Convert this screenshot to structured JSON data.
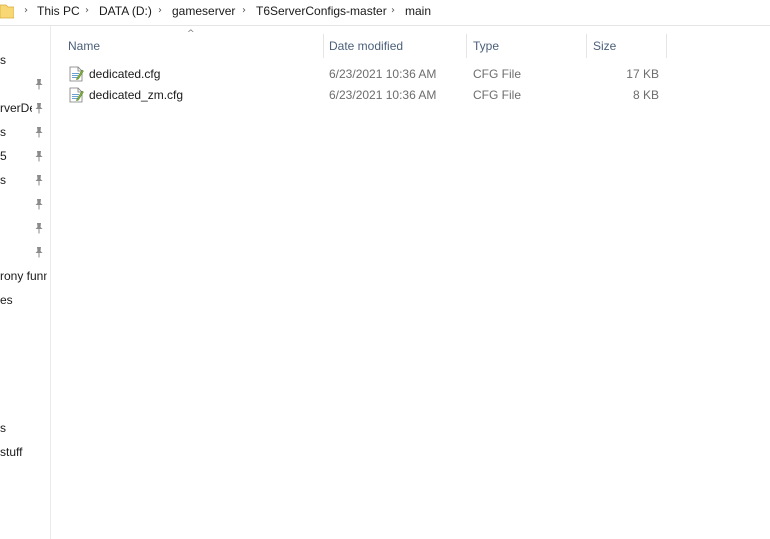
{
  "breadcrumb": {
    "separator": "›",
    "items": [
      "This PC",
      "DATA (D:)",
      "gameserver",
      "T6ServerConfigs-master",
      "main"
    ]
  },
  "nav_pane": {
    "items": [
      {
        "label": "s",
        "pinned": false
      },
      {
        "label": "",
        "pinned": true
      },
      {
        "label": "rverDefa",
        "pinned": true
      },
      {
        "label": "s",
        "pinned": true
      },
      {
        "label": "5",
        "pinned": true
      },
      {
        "label": "s",
        "pinned": true
      },
      {
        "label": "",
        "pinned": true
      },
      {
        "label": "",
        "pinned": true
      },
      {
        "label": "",
        "pinned": true
      },
      {
        "label": "rony funn",
        "pinned": false
      },
      {
        "label": "es",
        "pinned": false
      },
      {
        "label": "s",
        "pinned": false
      },
      {
        "label": "stuff",
        "pinned": false
      }
    ]
  },
  "file_list": {
    "columns": {
      "name": "Name",
      "date_modified": "Date modified",
      "type": "Type",
      "size": "Size"
    },
    "sort_arrow": "^",
    "rows": [
      {
        "name": "dedicated.cfg",
        "date_modified": "6/23/2021 10:36 AM",
        "type": "CFG File",
        "size": "17 KB",
        "icon": "cfg-file-icon"
      },
      {
        "name": "dedicated_zm.cfg",
        "date_modified": "6/23/2021 10:36 AM",
        "type": "CFG File",
        "size": "8 KB",
        "icon": "cfg-file-icon"
      }
    ]
  },
  "colors": {
    "header_text": "#4c607a",
    "folder_yellow": "#f8d775",
    "divider": "#e5e5e5"
  }
}
